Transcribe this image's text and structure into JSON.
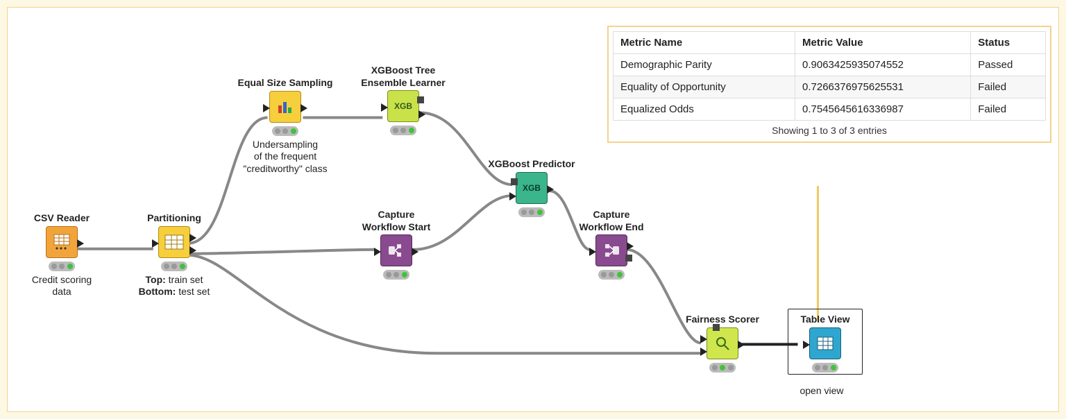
{
  "nodes": {
    "csv": {
      "title": "CSV Reader",
      "sub": "Credit scoring\ndata"
    },
    "partition": {
      "title": "Partitioning",
      "sub": "<b>Top:</b> train set\n<b>Bottom:</b> test set"
    },
    "sampling": {
      "title": "Equal Size Sampling",
      "sub": "Undersampling\nof the frequent\n\"creditworthy\" class"
    },
    "learner": {
      "title": "XGBoost Tree\nEnsemble Learner",
      "label": "XGB"
    },
    "capstart": {
      "title": "Capture\nWorkflow Start"
    },
    "predictor": {
      "title": "XGBoost Predictor",
      "label": "XGB"
    },
    "capend": {
      "title": "Capture\nWorkflow End"
    },
    "fairness": {
      "title": "Fairness Scorer"
    },
    "tableview": {
      "title": "Table View",
      "sub": "open view"
    }
  },
  "results": {
    "headers": [
      "Metric Name",
      "Metric Value",
      "Status"
    ],
    "rows": [
      [
        "Demographic Parity",
        "0.9063425935074552",
        "Passed"
      ],
      [
        "Equality of Opportunity",
        "0.7266376975625531",
        "Failed"
      ],
      [
        "Equalized Odds",
        "0.7545645616336987",
        "Failed"
      ]
    ],
    "footer": "Showing 1 to 3 of 3 entries"
  }
}
